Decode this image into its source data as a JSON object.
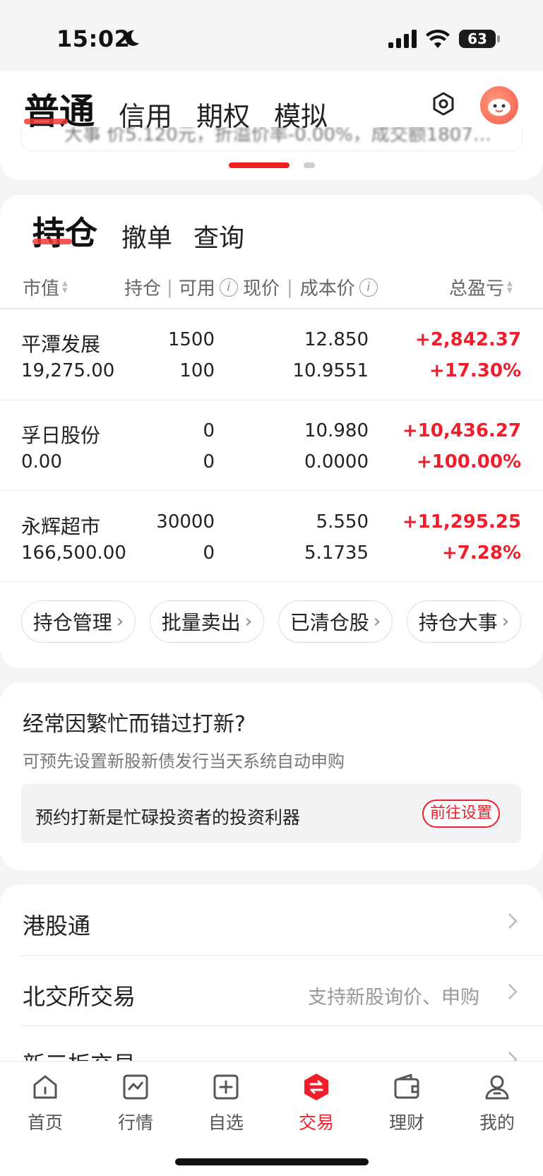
{
  "status": {
    "time": "15:02",
    "battery": "63"
  },
  "account_tabs": [
    "普通",
    "信用",
    "期权",
    "模拟"
  ],
  "ticker_partial": "大事 价5.120元，折溢价率-0.00%，成交额1807…",
  "holdings_tabs": [
    "持仓",
    "撤单",
    "查询"
  ],
  "columns": {
    "market_value": "市值",
    "position": "持仓",
    "separator": "|",
    "available": "可用",
    "price": "现价",
    "cost": "成本价",
    "pnl": "总盈亏"
  },
  "rows": [
    {
      "name": "平潭发展",
      "market_value": "19,275.00",
      "position": "1500",
      "available": "100",
      "price": "12.850",
      "cost": "10.9551",
      "pnl": "+2,842.37",
      "pnl_pct": "+17.30%"
    },
    {
      "name": "孚日股份",
      "market_value": "0.00",
      "position": "0",
      "available": "0",
      "price": "10.980",
      "cost": "0.0000",
      "pnl": "+10,436.27",
      "pnl_pct": "+100.00%"
    },
    {
      "name": "永辉超市",
      "market_value": "166,500.00",
      "position": "30000",
      "available": "0",
      "price": "5.550",
      "cost": "5.1735",
      "pnl": "+11,295.25",
      "pnl_pct": "+7.28%"
    }
  ],
  "actions": [
    "持仓管理",
    "批量卖出",
    "已清仓股",
    "持仓大事"
  ],
  "ipo": {
    "title": "经常因繁忙而错过打新?",
    "subtitle": "可预先设置新股新债发行当天系统自动申购",
    "box_text": "预约打新是忙碌投资者的投资利器",
    "button": "前往设置"
  },
  "list": [
    {
      "label": "港股通",
      "hint": ""
    },
    {
      "label": "北交所交易",
      "hint": "支持新股询价、申购"
    },
    {
      "label": "新三板交易",
      "hint": ""
    }
  ],
  "nav": [
    {
      "label": "首页",
      "icon": "home-icon"
    },
    {
      "label": "行情",
      "icon": "chart-icon"
    },
    {
      "label": "自选",
      "icon": "plus-box-icon"
    },
    {
      "label": "交易",
      "icon": "trade-icon",
      "active": true
    },
    {
      "label": "理财",
      "icon": "wallet-icon"
    },
    {
      "label": "我的",
      "icon": "profile-icon"
    }
  ],
  "colors": {
    "accent_red": "#f01e2a"
  }
}
